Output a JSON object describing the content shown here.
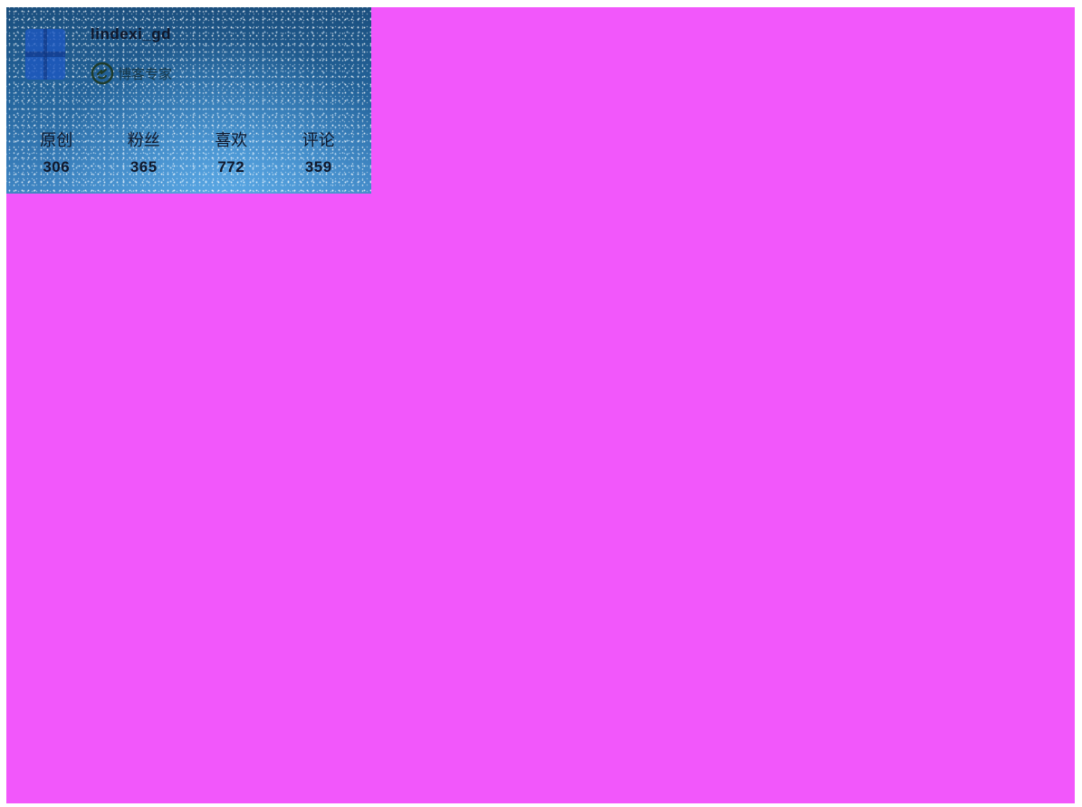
{
  "page": {
    "background_color": "#f257fb"
  },
  "profile": {
    "username": "lindexi_gd",
    "avatar_icon": "avatar-image",
    "badge": {
      "icon": "blog-expert-badge-icon",
      "label": "博客专家"
    },
    "stats": [
      {
        "label": "原创",
        "value": "306"
      },
      {
        "label": "粉丝",
        "value": "365"
      },
      {
        "label": "喜欢",
        "value": "772"
      },
      {
        "label": "评论",
        "value": "359"
      }
    ]
  }
}
